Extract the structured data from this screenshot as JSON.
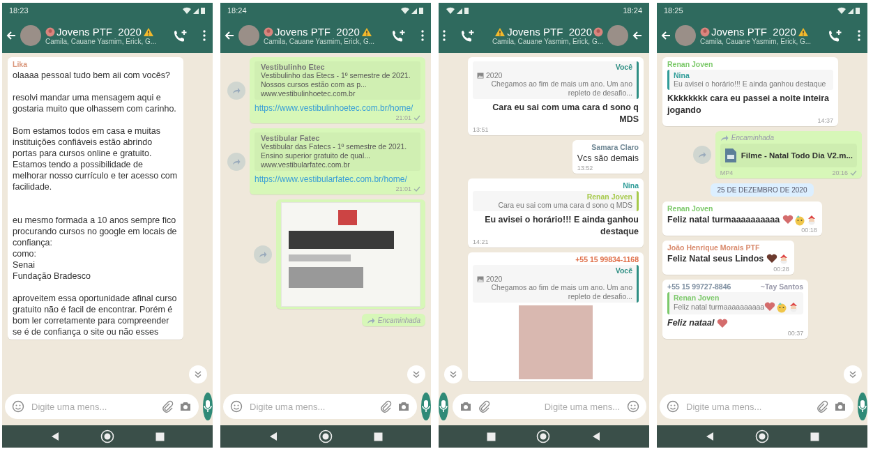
{
  "phones": [
    {
      "time": "18:23",
      "mirrored": false,
      "title": "Jovens PTF  2020",
      "subtitle": "Camila, Cauane Yasmim, Erick, G...",
      "placeholder": "Digite uma mens...",
      "messages": [
        {
          "kind": "text",
          "outgoing": false,
          "sender": "Lika",
          "color": "#d9967a",
          "text": "olaaaa pessoal tudo bem aii com vocês?\n\nresolvi mandar uma mensagem aqui e gostaria muito que olhassem com carinho.\n\nBom estamos todos em casa e muitas instituições confiáveis estão abrindo portas para cursos online e gratuito.\nEstamos tendo a possibilidade de melhorar nosso currículo e ter acesso com facilidade.\n\n\neu mesmo formada a 10 anos sempre fico procurando cursos no google em locais de confiança:\ncomo:\nSenai\nFundação Bradesco\n\naproveitem essa oportunidade afinal curso gratuito não é facil de encontrar. Porém é bom ler corretamente para compreender se é de confiança o site ou não esses"
        }
      ]
    },
    {
      "time": "18:24",
      "mirrored": false,
      "title": "Jovens PTF  2020",
      "subtitle": "Camila, Cauane Yasmim, Erick, G...",
      "placeholder": "Digite uma mens...",
      "messages": [
        {
          "kind": "link",
          "outgoing": true,
          "forward_button": true,
          "link_title": "Vestibulinho Etec",
          "link_desc": "Vestibulinho das Etecs - 1º semestre de 2021. Nossos cursos estão com as p...",
          "domain": "www.vestibulinhoetec.com.br",
          "url": "https://www.vestibulinhoetec.com.br/home/",
          "time": "21:01",
          "sent": true
        },
        {
          "kind": "link",
          "outgoing": true,
          "forward_button": true,
          "link_title": "Vestibular Fatec",
          "link_desc": "Vestibular das Fatecs - 1º semestre de 2021. Ensino superior gratuito de qual...",
          "domain": "www.vestibularfatec.com.br",
          "url": "https://www.vestibularfatec.com.br/home/",
          "time": "21:01",
          "sent": true
        },
        {
          "kind": "image",
          "outgoing": true,
          "forward_button": true
        },
        {
          "kind": "text",
          "outgoing": true,
          "forwarded_label": "Encaminhada"
        }
      ]
    },
    {
      "time": "18:24",
      "mirrored": true,
      "title": "Jovens PTF  2020",
      "subtitle": "Camila, Cauane Yasmim, Erick, G...",
      "placeholder": "Digite uma mens...",
      "messages": [
        {
          "kind": "text",
          "outgoing": false,
          "quote": {
            "author": "Você",
            "color": "#2f8f84",
            "photo_icon": true,
            "caption": "2020",
            "text": "Chegamos ao fim de mais um ano. Um ano repleto de desafio..."
          },
          "text": "Cara eu sai com uma cara d sono q MDS",
          "time": "13:51"
        },
        {
          "kind": "text",
          "outgoing": false,
          "sender": "Samara Claro",
          "color": "#6f8794",
          "text": "Vcs são demais",
          "time": "13:52"
        },
        {
          "kind": "text",
          "outgoing": false,
          "sender": "Nina",
          "color": "#2f9c98",
          "quote": {
            "author": "Renan Joven",
            "color": "#a6c94a",
            "text": "Cara eu sai com uma cara d sono q MDS"
          },
          "text": "Eu avisei o horário!!! E ainda ganhou destaque",
          "time": "14:21"
        },
        {
          "kind": "text",
          "outgoing": false,
          "sender": "+55 15 99834-1168",
          "color": "#e0704a",
          "quote": {
            "author": "Você",
            "color": "#2f8f84",
            "photo_icon": true,
            "caption": "2020",
            "text": "Chegamos ao fim de mais um ano. Um ano repleto de desafio..."
          },
          "has_photo": true
        }
      ]
    },
    {
      "time": "18:25",
      "mirrored": false,
      "title": "Jovens PTF  2020",
      "subtitle": "Camila, Cauane Yasmim, Erick, G...",
      "placeholder": "Digite uma mens...",
      "messages": [
        {
          "kind": "text",
          "outgoing": false,
          "sender": "Renan Joven",
          "color": "#7cc96a",
          "quote": {
            "author": "Nina",
            "color": "#2f9c98",
            "text": "Eu avisei o horário!!! E ainda ganhou destaque"
          },
          "text": "Kkkkkkkk cara eu passei a noite inteira jogando",
          "time": "14:37"
        },
        {
          "kind": "file",
          "outgoing": true,
          "forward_button": true,
          "forwarded_label": "Encaminhada",
          "file_name": "Filme - Natal Todo Dia V2.m...",
          "file_type": "MP4",
          "time": "20:16",
          "sent": true
        },
        {
          "kind": "date",
          "text": "25 DE DEZEMBRO DE 2020"
        },
        {
          "kind": "text",
          "outgoing": false,
          "sender": "Renan Joven",
          "color": "#7cc96a",
          "text": "Feliz natal turmaaaaaaaaaa",
          "emojis": [
            {
              "kind": "heart"
            },
            {
              "kind": "party"
            },
            {
              "kind": "santa"
            }
          ],
          "time": "00:18"
        },
        {
          "kind": "text",
          "outgoing": false,
          "sender": "João Henrique Morais PTF",
          "color": "#d98a6c",
          "text": "Feliz Natal seus Lindos",
          "emojis": [
            {
              "kind": "brown-heart"
            },
            {
              "kind": "santa"
            }
          ],
          "time": "00:28"
        },
        {
          "kind": "text",
          "outgoing": false,
          "sender": "+55 15 99727-8846",
          "color": "#7d8ea0",
          "push_name": "~Tay Santos",
          "quote": {
            "author": "Renan Joven",
            "color": "#7cc96a",
            "text": "Feliz natal turmaaaaaaaaaa",
            "emojis": [
              {
                "kind": "heart"
              },
              {
                "kind": "party"
              },
              {
                "kind": "santa"
              }
            ]
          },
          "text": "Feliz nataal",
          "italic": true,
          "emojis": [
            {
              "kind": "heart"
            }
          ],
          "time": "00:37"
        }
      ]
    }
  ]
}
